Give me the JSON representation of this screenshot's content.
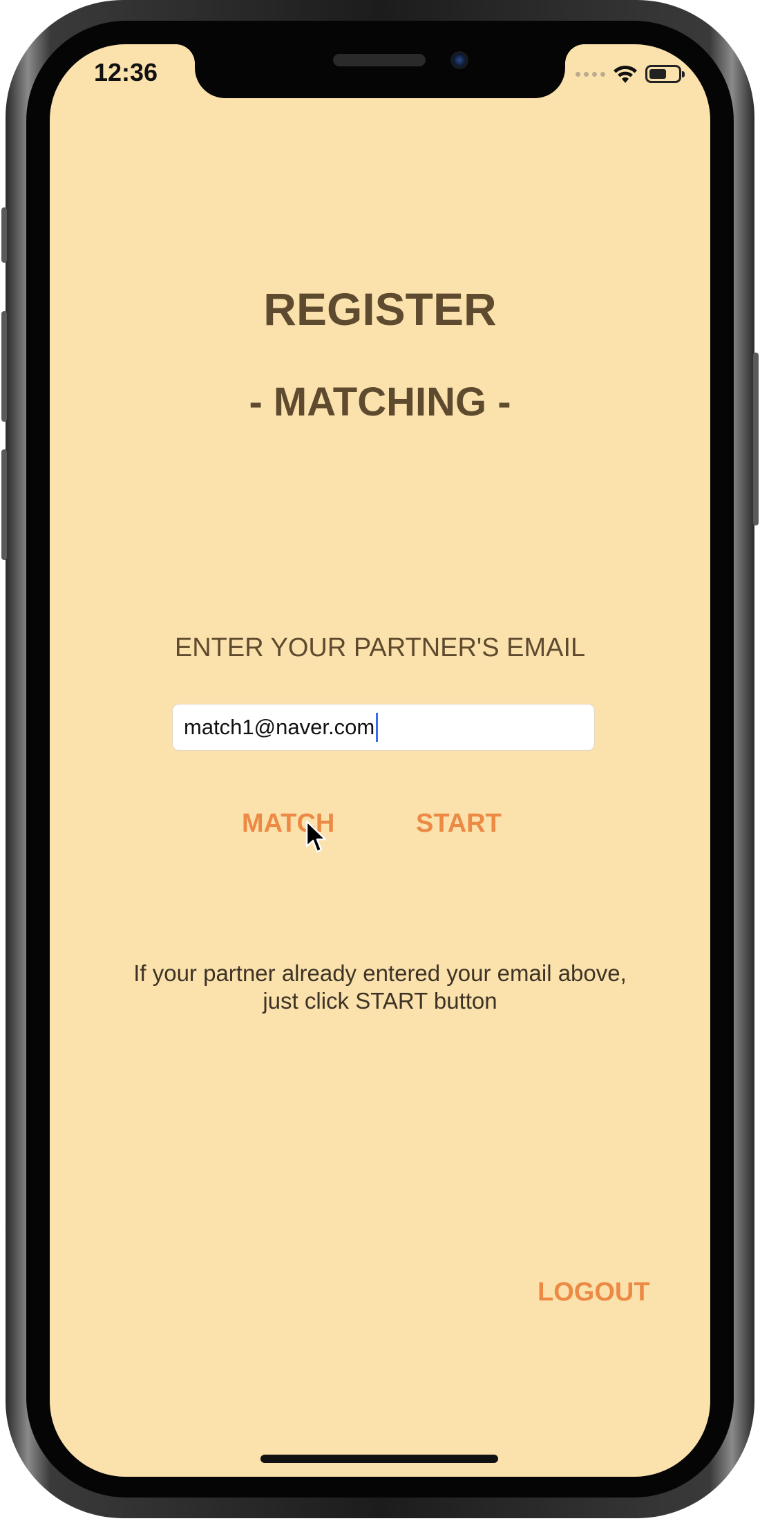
{
  "status_bar": {
    "time": "12:36",
    "wifi_icon": "wifi-icon",
    "battery_icon": "battery-icon"
  },
  "screen": {
    "title": "REGISTER",
    "subtitle": "- MATCHING -",
    "prompt": "ENTER YOUR PARTNER'S EMAIL",
    "email_value": "match1@naver.com",
    "match_label": "MATCH",
    "start_label": "START",
    "help_line1": "If your partner already entered your email above,",
    "help_line2": "just click START button",
    "logout_label": "LOGOUT"
  },
  "colors": {
    "background": "#fbe2ad",
    "heading": "#5e4a2e",
    "accent": "#ec8a45"
  }
}
